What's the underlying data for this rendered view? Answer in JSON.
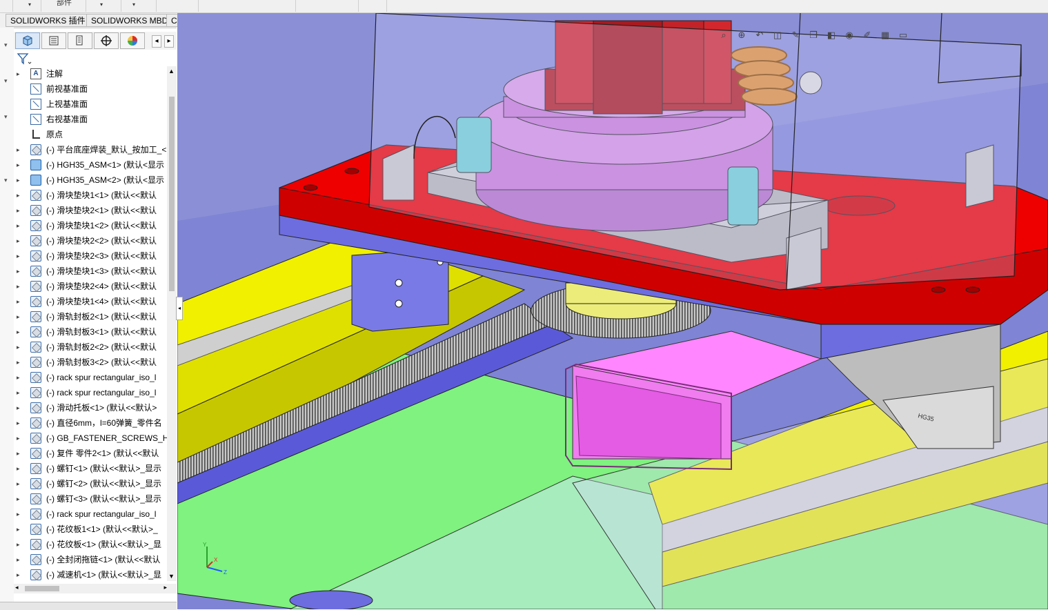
{
  "top_strip": {
    "center_label": "部件"
  },
  "command_tabs": [
    {
      "label": "SOLIDWORKS 插件"
    },
    {
      "label": "SOLIDWORKS MBD"
    },
    {
      "label": "CircuitWorks"
    }
  ],
  "feature_manager": {
    "tabs": [
      {
        "icon": "featuremanager-icon"
      },
      {
        "icon": "propertymanager-icon"
      },
      {
        "icon": "configurationmanager-icon"
      },
      {
        "icon": "dimxpertmanager-icon"
      },
      {
        "icon": "displaymanager-icon"
      }
    ],
    "filter_icon": "filter-icon",
    "items": [
      {
        "label": "注解",
        "icon": "annotation"
      },
      {
        "label": "前视基准面",
        "icon": "plane"
      },
      {
        "label": "上视基准面",
        "icon": "plane"
      },
      {
        "label": "右视基准面",
        "icon": "plane"
      },
      {
        "label": "原点",
        "icon": "origin"
      },
      {
        "label": "(-) 平台底座焊装_默认_按加工_<",
        "icon": "part"
      },
      {
        "label": "(-) HGH35_ASM<1> (默认<显示",
        "icon": "assembly"
      },
      {
        "label": "(-) HGH35_ASM<2> (默认<显示",
        "icon": "assembly"
      },
      {
        "label": "(-) 滑块垫块1<1> (默认<<默认",
        "icon": "part"
      },
      {
        "label": "(-) 滑块垫块2<1> (默认<<默认",
        "icon": "part"
      },
      {
        "label": "(-) 滑块垫块1<2> (默认<<默认",
        "icon": "part"
      },
      {
        "label": "(-) 滑块垫块2<2> (默认<<默认",
        "icon": "part"
      },
      {
        "label": "(-) 滑块垫块2<3> (默认<<默认",
        "icon": "part"
      },
      {
        "label": "(-) 滑块垫块1<3> (默认<<默认",
        "icon": "part"
      },
      {
        "label": "(-) 滑块垫块2<4> (默认<<默认",
        "icon": "part"
      },
      {
        "label": "(-) 滑块垫块1<4> (默认<<默认",
        "icon": "part"
      },
      {
        "label": "(-) 滑轨封板2<1> (默认<<默认",
        "icon": "part"
      },
      {
        "label": "(-) 滑轨封板3<1> (默认<<默认",
        "icon": "part"
      },
      {
        "label": "(-) 滑轨封板2<2> (默认<<默认",
        "icon": "part"
      },
      {
        "label": "(-) 滑轨封板3<2> (默认<<默认",
        "icon": "part"
      },
      {
        "label": "(-) rack spur rectangular_iso_l",
        "icon": "part"
      },
      {
        "label": "(-) rack spur rectangular_iso_l",
        "icon": "part"
      },
      {
        "label": "(-) 滑动托板<1> (默认<<默认>",
        "icon": "part"
      },
      {
        "label": "(-) 直径6mm，l=60弹簧_零件名",
        "icon": "part"
      },
      {
        "label": "(-) GB_FASTENER_SCREWS_HS",
        "icon": "part"
      },
      {
        "label": "(-) 复件 零件2<1> (默认<<默认",
        "icon": "part"
      },
      {
        "label": "(-) 螺钉<1> (默认<<默认>_显示",
        "icon": "part"
      },
      {
        "label": "(-) 螺钉<2> (默认<<默认>_显示",
        "icon": "part"
      },
      {
        "label": "(-) 螺钉<3> (默认<<默认>_显示",
        "icon": "part"
      },
      {
        "label": "(-) rack spur rectangular_iso_l",
        "icon": "part"
      },
      {
        "label": "(-) 花纹板1<1> (默认<<默认>_",
        "icon": "part"
      },
      {
        "label": "(-) 花纹板<1> (默认<<默认>_显",
        "icon": "part"
      },
      {
        "label": "(-) 全封闭拖链<1> (默认<<默认",
        "icon": "part"
      },
      {
        "label": "(-) 减速机<1> (默认<<默认>_显",
        "icon": "part"
      }
    ]
  },
  "viewport": {
    "heads_up_icons": [
      "zoom-to-fit-icon",
      "zoom-area-icon",
      "previous-view-icon",
      "section-view-icon",
      "dynamic-annotation-icon",
      "view-orientation-icon",
      "display-style-icon",
      "hide-show-icon",
      "edit-appearance-icon",
      "apply-scene-icon",
      "view-settings-icon"
    ],
    "rail_label": "HG35",
    "triad_labels": {
      "x": "X",
      "y": "Y",
      "z": "Z"
    }
  },
  "colors": {
    "background_blue": "#8a8fd6",
    "platform_red": "#ee0000",
    "rail_yellow": "#f1f000",
    "floor_green": "#7ff27f",
    "tube_magenta": "#f07cf0",
    "motor_red": "#d2282d",
    "flange_purple": "#c97ad6"
  }
}
